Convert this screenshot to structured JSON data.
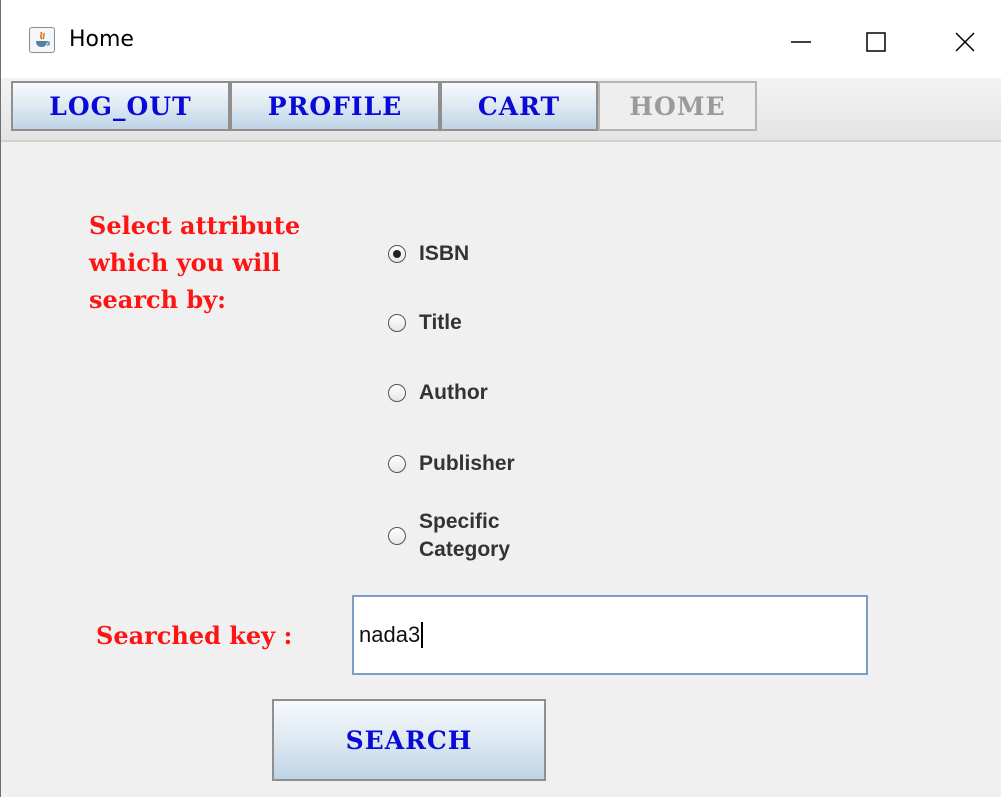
{
  "window": {
    "title": "Home",
    "icon": "java-icon"
  },
  "toolbar": {
    "tabs": [
      {
        "label": "LOG_OUT"
      },
      {
        "label": "PROFILE"
      },
      {
        "label": "CART"
      },
      {
        "label": "HOME",
        "disabled": true
      }
    ]
  },
  "search_form": {
    "prompt_lines": [
      "Select attribute",
      "which you will",
      "search by:"
    ],
    "options": [
      {
        "label": "ISBN",
        "selected": true
      },
      {
        "label": "Title",
        "selected": false
      },
      {
        "label": "Author",
        "selected": false
      },
      {
        "label": "Publisher",
        "selected": false
      },
      {
        "label_lines": [
          "Specific",
          "Category"
        ],
        "selected": false
      }
    ],
    "key_label": "Searched key :",
    "key_value": "nada3",
    "search_button_label": "SEARCH"
  },
  "colors": {
    "prompt": "#ff1414",
    "button_text": "#0a0ad6",
    "field_border": "#7a9ec4"
  }
}
